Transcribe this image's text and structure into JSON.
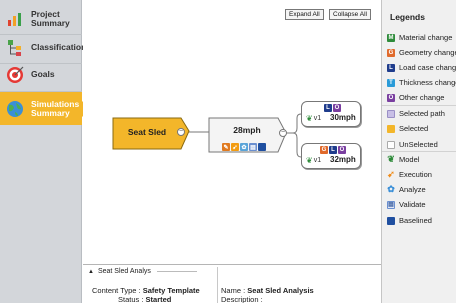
{
  "sidebar": {
    "items": [
      {
        "label": "Project Summary",
        "icon": "bar-chart-icon"
      },
      {
        "label": "Classification",
        "icon": "hierarchy-icon"
      },
      {
        "label": "Goals",
        "icon": "target-icon"
      },
      {
        "label": "Simulations Summary",
        "icon": "globe-icon",
        "active": true
      }
    ]
  },
  "toolbar": {
    "expand_all": "Expand All",
    "collapse_all": "Collapse All"
  },
  "flow": {
    "start": {
      "label": "Seat Sled",
      "collapse": "−"
    },
    "mid": {
      "label": "28mph",
      "collapse": "−"
    },
    "ends": [
      {
        "version": "v1",
        "value": "30mph",
        "badges": [
          "L",
          "O"
        ]
      },
      {
        "version": "v1",
        "value": "32mph",
        "badges": [
          "G",
          "L",
          "O"
        ]
      }
    ]
  },
  "details": {
    "header": "Seat Sled Analys",
    "content_type_label": "Content Type :",
    "content_type": "Safety Template",
    "status_label": "Status :",
    "status": "Started",
    "name_label": "Name :",
    "name": "Seat Sled Analysis",
    "description_label": "Description :"
  },
  "legend": {
    "title": "Legends",
    "items": [
      {
        "label": "Material change",
        "letter": "M",
        "color": "#2e8b3a"
      },
      {
        "label": "Geometry change",
        "letter": "G",
        "color": "#e06a2c"
      },
      {
        "label": "Load case change",
        "letter": "L",
        "color": "#1f3c8c"
      },
      {
        "label": "Thickness change",
        "letter": "T",
        "color": "#2a9bd8"
      },
      {
        "label": "Other change",
        "letter": "O",
        "color": "#7a3fa0"
      },
      {
        "label": "Selected path",
        "letter": "",
        "color": "#c8bfe6"
      },
      {
        "label": "Selected",
        "letter": "",
        "color": "#f3b62a"
      },
      {
        "label": "UnSelected",
        "letter": "",
        "color": "#ffffff"
      },
      {
        "label": "Model",
        "icon": "model-icon"
      },
      {
        "label": "Execution",
        "icon": "execution-icon"
      },
      {
        "label": "Analyze",
        "icon": "analyze-icon"
      },
      {
        "label": "Validate",
        "icon": "validate-icon"
      },
      {
        "label": "Baselined",
        "icon": "baselined-icon",
        "color": "#1f4fa0"
      }
    ]
  }
}
